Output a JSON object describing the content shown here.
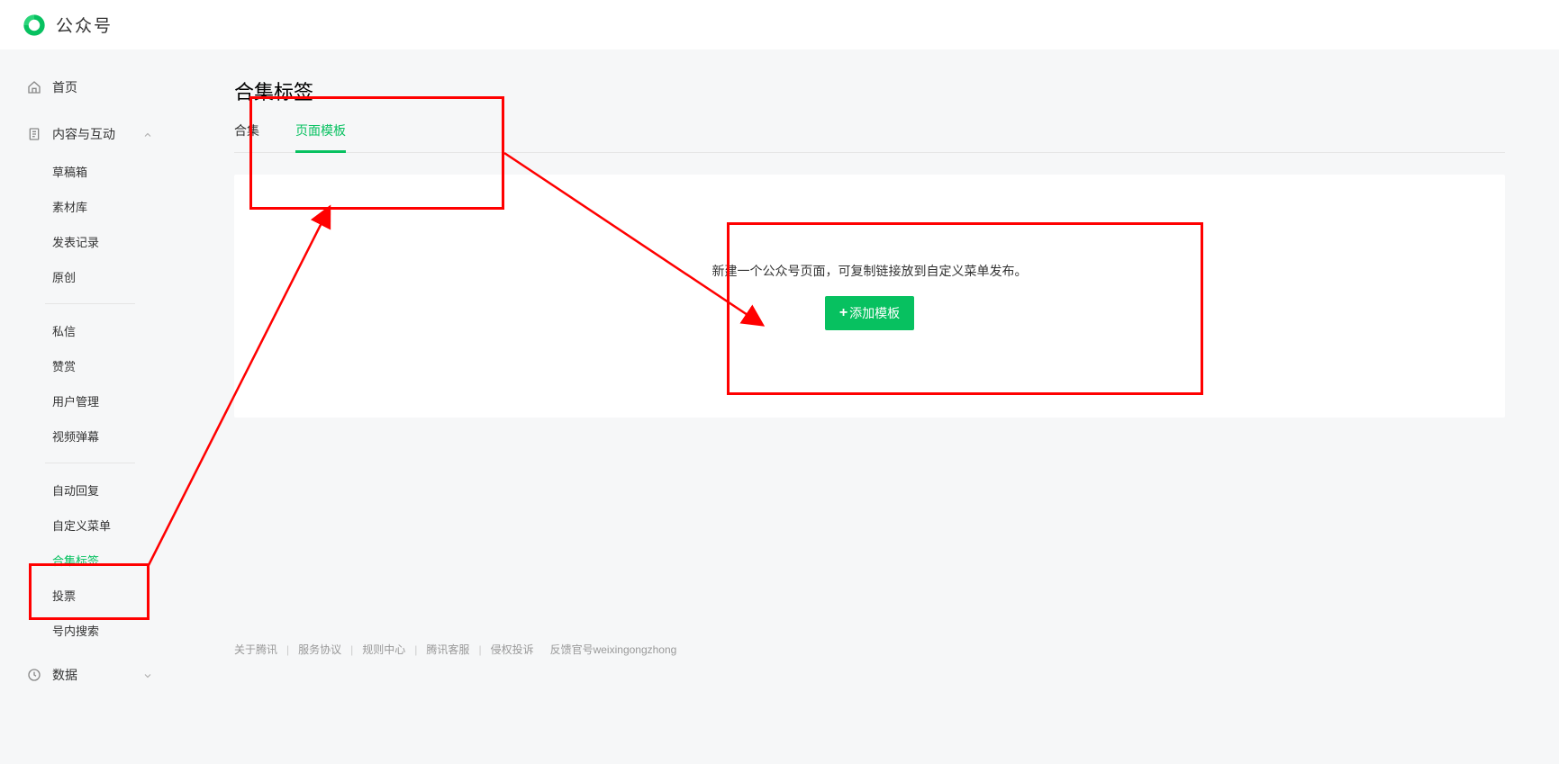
{
  "header": {
    "title": "公众号"
  },
  "sidebar": {
    "sections": [
      {
        "label": "首页",
        "icon": "home"
      },
      {
        "label": "内容与互动",
        "icon": "doc",
        "expanded": true,
        "groups": [
          [
            "草稿箱",
            "素材库",
            "发表记录",
            "原创"
          ],
          [
            "私信",
            "赞赏",
            "用户管理",
            "视频弹幕"
          ],
          [
            "自动回复",
            "自定义菜单",
            "合集标签",
            "投票",
            "号内搜索"
          ]
        ],
        "active": "合集标签"
      },
      {
        "label": "数据",
        "icon": "clock"
      }
    ]
  },
  "page": {
    "title": "合集标签",
    "tabs": [
      "合集",
      "页面模板"
    ],
    "active_tab": "页面模板",
    "card": {
      "desc": "新建一个公众号页面，可复制链接放到自定义菜单发布。",
      "button": "添加模板"
    }
  },
  "footer": {
    "links": [
      "关于腾讯",
      "服务协议",
      "规则中心",
      "腾讯客服",
      "侵权投诉"
    ],
    "feedback_label": "反馈官号",
    "feedback_account": "weixingongzhong"
  }
}
